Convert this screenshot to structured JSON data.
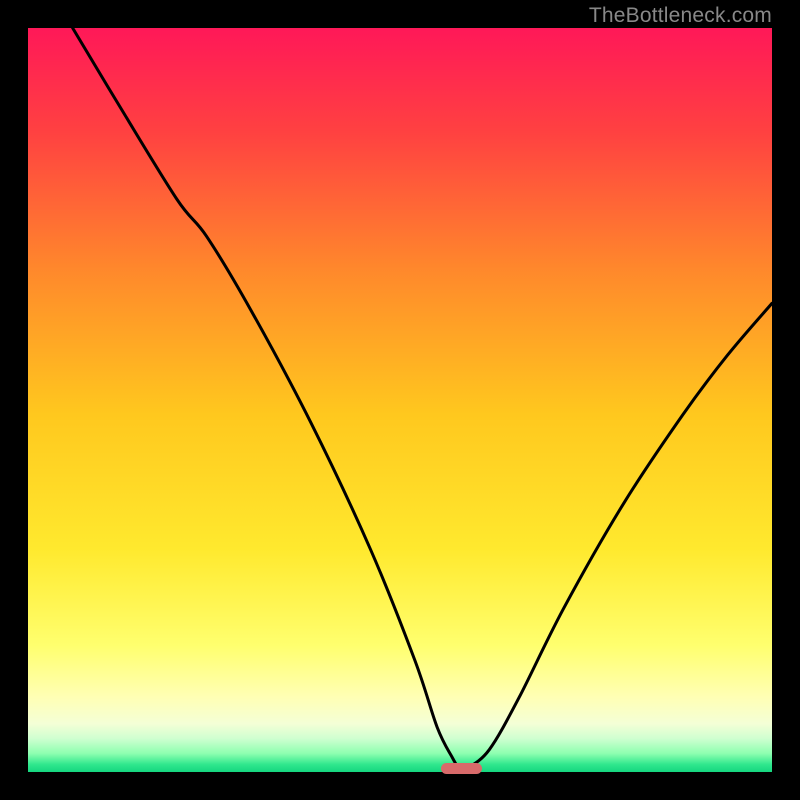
{
  "watermark": "TheBottleneck.com",
  "accent_marker_color": "#d86a6a",
  "chart_data": {
    "type": "line",
    "title": "",
    "xlabel": "",
    "ylabel": "",
    "xlim": [
      0,
      100
    ],
    "ylim": [
      0,
      100
    ],
    "gradient_stops": [
      {
        "offset": 0,
        "color": "#ff1858"
      },
      {
        "offset": 0.14,
        "color": "#ff4141"
      },
      {
        "offset": 0.33,
        "color": "#ff8a2b"
      },
      {
        "offset": 0.52,
        "color": "#ffc81e"
      },
      {
        "offset": 0.7,
        "color": "#ffe92e"
      },
      {
        "offset": 0.83,
        "color": "#ffff6e"
      },
      {
        "offset": 0.9,
        "color": "#ffffb5"
      },
      {
        "offset": 0.935,
        "color": "#f4ffd6"
      },
      {
        "offset": 0.955,
        "color": "#cfffd0"
      },
      {
        "offset": 0.975,
        "color": "#8effb0"
      },
      {
        "offset": 0.99,
        "color": "#2fe78d"
      },
      {
        "offset": 1.0,
        "color": "#15d67f"
      }
    ],
    "series": [
      {
        "name": "bottleneck-curve",
        "x": [
          6,
          12,
          20,
          24,
          30,
          38,
          46,
          52,
          55,
          57,
          58,
          59,
          62,
          66,
          72,
          80,
          88,
          94,
          100
        ],
        "y": [
          100,
          90,
          77,
          72,
          62,
          47,
          30,
          15,
          6,
          2,
          0.5,
          0.5,
          3,
          10,
          22,
          36,
          48,
          56,
          63
        ]
      }
    ],
    "minimum_marker": {
      "x_start": 55.5,
      "x_end": 61,
      "y": 0.6
    }
  }
}
